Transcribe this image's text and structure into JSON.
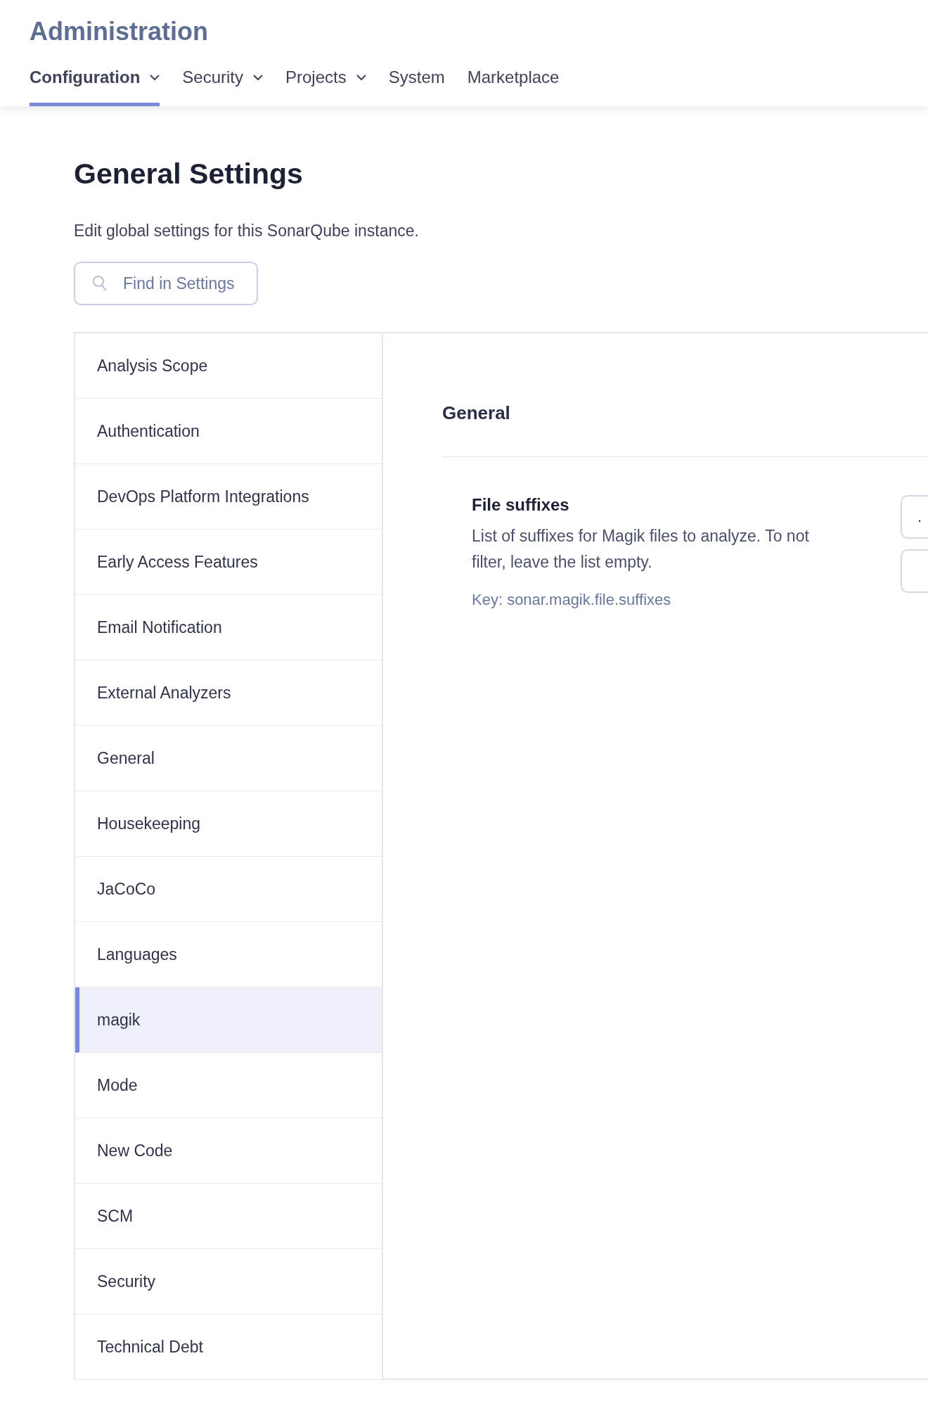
{
  "header": {
    "title": "Administration",
    "tabs": [
      {
        "label": "Configuration",
        "selected": true,
        "dropdown": true
      },
      {
        "label": "Security",
        "selected": false,
        "dropdown": true
      },
      {
        "label": "Projects",
        "selected": false,
        "dropdown": true
      },
      {
        "label": "System",
        "selected": false,
        "dropdown": false
      },
      {
        "label": "Marketplace",
        "selected": false,
        "dropdown": false
      }
    ]
  },
  "page": {
    "title": "General Settings",
    "subtitle": "Edit global settings for this SonarQube instance.",
    "search": {
      "placeholder": "Find in Settings"
    }
  },
  "sidebar": {
    "items": [
      {
        "label": "Analysis Scope",
        "selected": false
      },
      {
        "label": "Authentication",
        "selected": false
      },
      {
        "label": "DevOps Platform Integrations",
        "selected": false
      },
      {
        "label": "Early Access Features",
        "selected": false
      },
      {
        "label": "Email Notification",
        "selected": false
      },
      {
        "label": "External Analyzers",
        "selected": false
      },
      {
        "label": "General",
        "selected": false
      },
      {
        "label": "Housekeeping",
        "selected": false
      },
      {
        "label": "JaCoCo",
        "selected": false
      },
      {
        "label": "Languages",
        "selected": false
      },
      {
        "label": "magik",
        "selected": true
      },
      {
        "label": "Mode",
        "selected": false
      },
      {
        "label": "New Code",
        "selected": false
      },
      {
        "label": "SCM",
        "selected": false
      },
      {
        "label": "Security",
        "selected": false
      },
      {
        "label": "Technical Debt",
        "selected": false
      }
    ]
  },
  "content": {
    "section": "General",
    "settings": [
      {
        "name": "File suffixes",
        "description": "List of suffixes for Magik files to analyze. To not filter, leave the list empty.",
        "key": "Key: sonar.magik.file.suffixes",
        "fields": [
          {
            "kind": "filled",
            "value": "."
          },
          {
            "kind": "blank"
          }
        ]
      }
    ]
  }
}
